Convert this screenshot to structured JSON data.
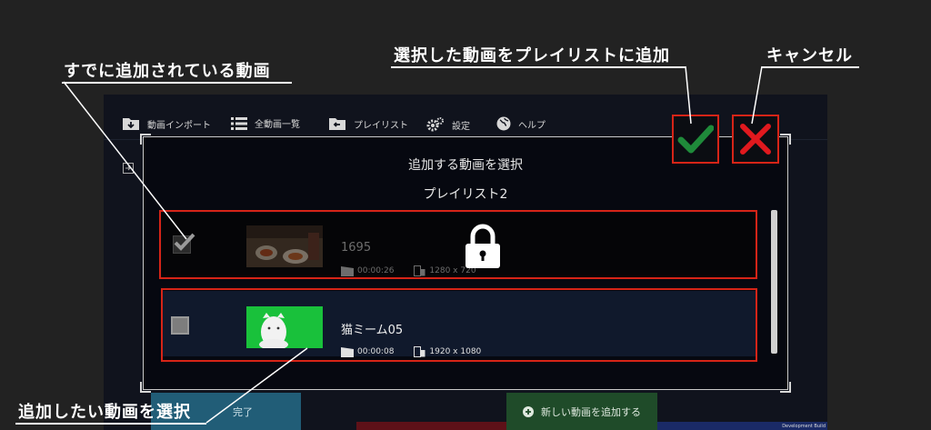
{
  "nav": {
    "import": "動画インポート",
    "all_videos": "全動画一覧",
    "playlist": "プレイリスト",
    "settings": "設定",
    "help": "ヘルプ"
  },
  "dialog": {
    "title": "追加する動画を選択",
    "playlist_name": "プレイリスト2"
  },
  "videos": [
    {
      "title": "1695",
      "duration": "00:00:26",
      "resolution": "1280 x 720",
      "already_added": true,
      "locked": true
    },
    {
      "title": "猫ミーム05",
      "duration": "00:00:08",
      "resolution": "1920 x 1080",
      "already_added": false,
      "locked": false
    }
  ],
  "bottom": {
    "done": "完了",
    "add_new": "新しい動画を追加する",
    "dev_build": "Development Build"
  },
  "annotations": {
    "already_added": "すでに追加されている動画",
    "add_selected": "選択した動画をプレイリストに追加",
    "cancel": "キャンセル",
    "select_video": "追加したい動画を選択"
  },
  "colors": {
    "highlight": "#d62417",
    "confirm": "#1f8a3a",
    "cancel": "#e0191e",
    "add_button": "#1f4b29",
    "done_button": "#215d77"
  },
  "icons": {
    "confirm": "check-icon",
    "cancel": "x-icon",
    "locked": "lock-icon"
  }
}
